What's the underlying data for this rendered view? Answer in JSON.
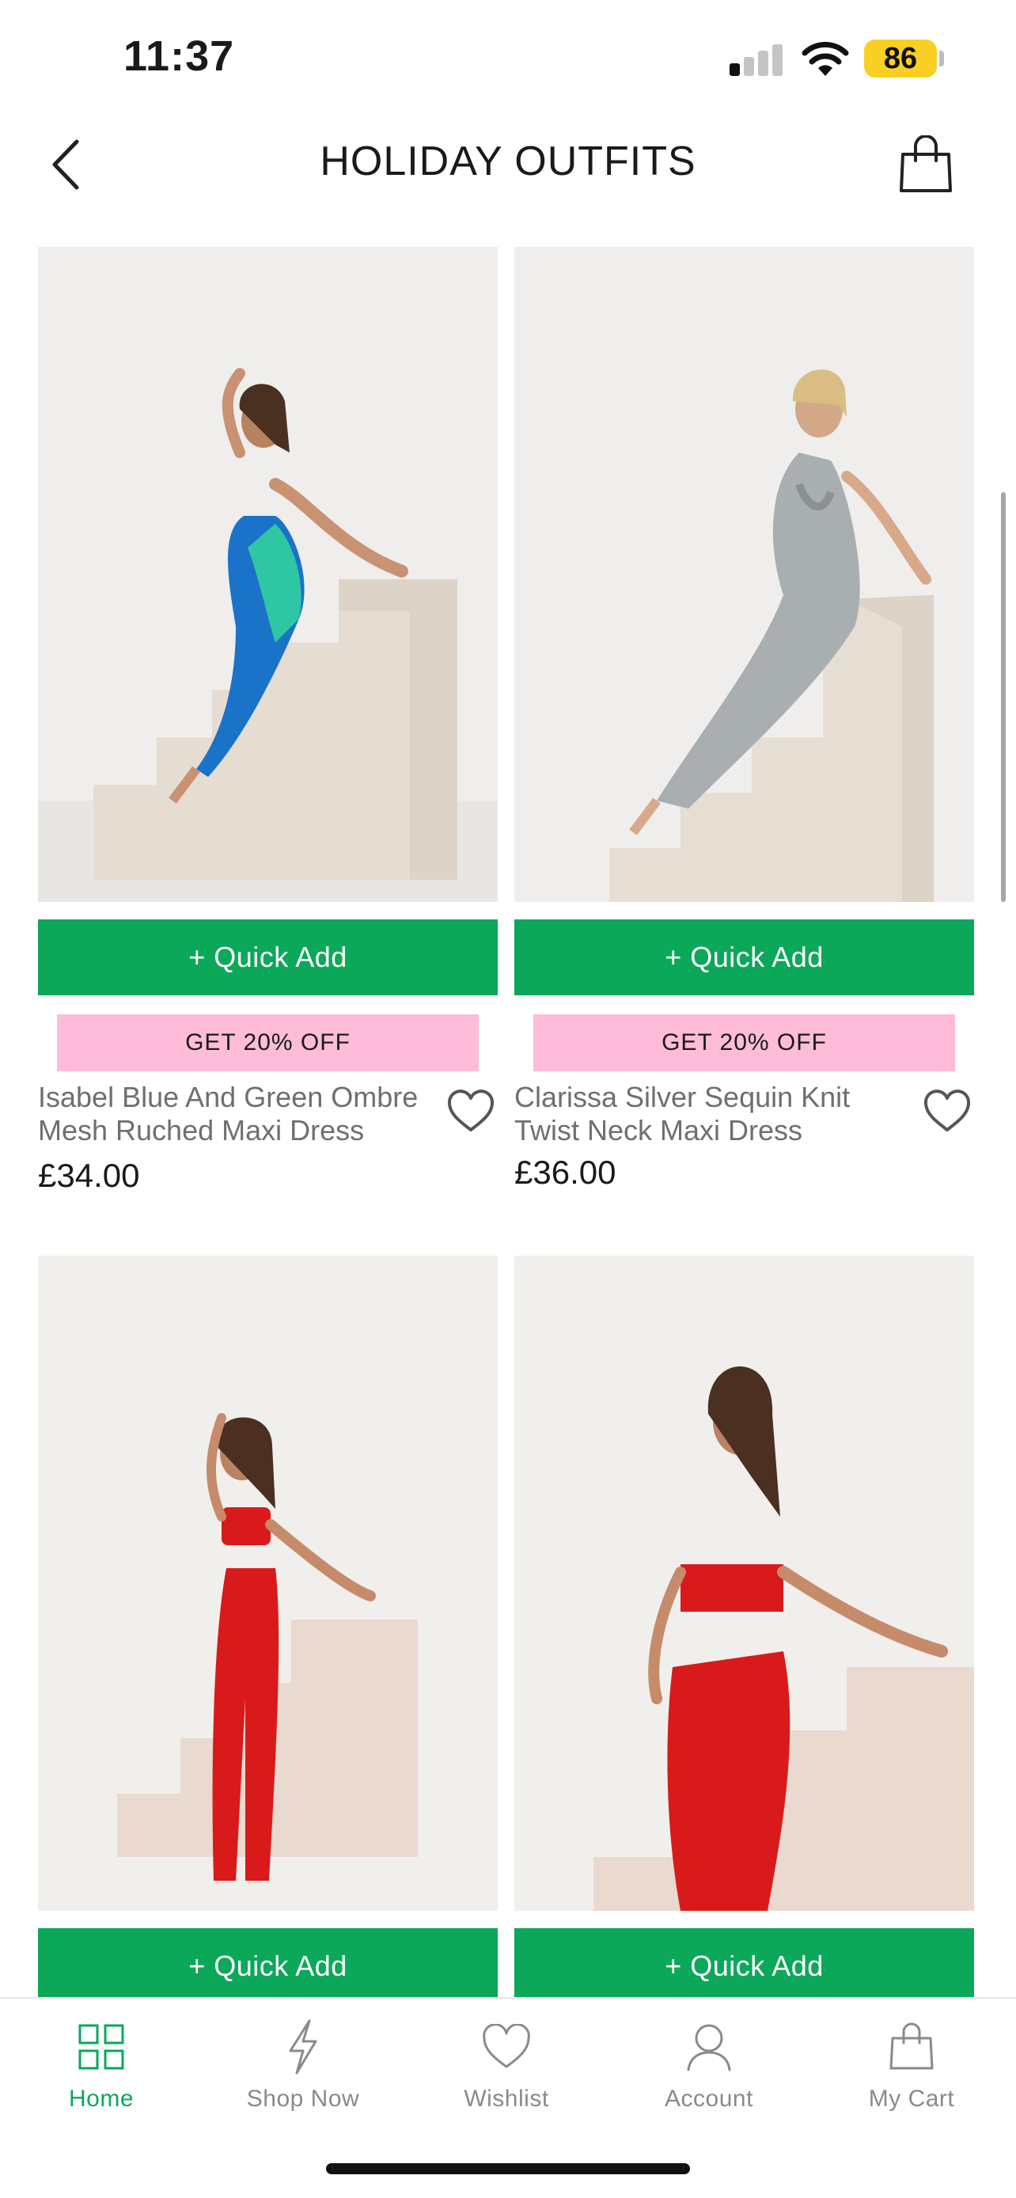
{
  "status_bar": {
    "time": "11:37",
    "battery": "86",
    "signal_bars_on": 1,
    "signal_bars_total": 4
  },
  "header": {
    "title": "HOLIDAY OUTFITS",
    "back_icon": "chevron-left-icon",
    "bag_icon": "shopping-bag-icon"
  },
  "colors": {
    "accent_green": "#0ba85a",
    "promo_pink": "#ffbcd8",
    "battery_yellow": "#f9cf23"
  },
  "products": [
    {
      "name": "Isabel Blue And Green Ombre Mesh Ruched Maxi Dress",
      "price": "£34.00",
      "quick_add": "+ Quick Add",
      "promo": "GET 20% OFF",
      "image_desc": "blue-green-ombre-maxi-dress"
    },
    {
      "name": "Clarissa Silver Sequin Knit Twist Neck Maxi Dress",
      "price": "£36.00",
      "quick_add": "+ Quick Add",
      "promo": "GET 20% OFF",
      "image_desc": "silver-sequin-maxi-dress"
    },
    {
      "quick_add": "+ Quick Add",
      "image_desc": "red-lace-co-ord"
    },
    {
      "quick_add": "+ Quick Add",
      "image_desc": "red-lace-halter-co-ord"
    }
  ],
  "tab_bar": {
    "items": [
      {
        "label": "Home",
        "icon": "grid-icon",
        "active": true
      },
      {
        "label": "Shop Now",
        "icon": "lightning-icon",
        "active": false
      },
      {
        "label": "Wishlist",
        "icon": "heart-icon",
        "active": false
      },
      {
        "label": "Account",
        "icon": "user-icon",
        "active": false
      },
      {
        "label": "My Cart",
        "icon": "shopping-bag-icon",
        "active": false
      }
    ]
  }
}
